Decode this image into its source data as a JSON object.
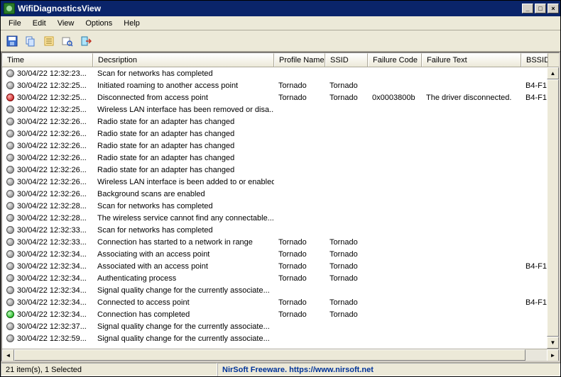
{
  "window": {
    "title": "WifiDiagnosticsView"
  },
  "menu": {
    "file": "File",
    "edit": "Edit",
    "view": "View",
    "options": "Options",
    "help": "Help"
  },
  "columns": {
    "time": "Time",
    "desc": "Decsription",
    "profile": "Profile Name",
    "ssid": "SSID",
    "fcode": "Failure Code",
    "ftext": "Failure Text",
    "bssid": "BSSID"
  },
  "status": {
    "left": "21 item(s), 1 Selected",
    "right": "NirSoft Freeware. https://www.nirsoft.net"
  },
  "rows": [
    {
      "dot": "gray",
      "time": "30/04/22 12:32:23...",
      "desc": "Scan for networks has completed",
      "profile": "",
      "ssid": "",
      "fcode": "",
      "ftext": "",
      "bssid": ""
    },
    {
      "dot": "gray",
      "time": "30/04/22 12:32:25...",
      "desc": "Initiated roaming to another access point",
      "profile": "Tornado",
      "ssid": "Tornado",
      "fcode": "",
      "ftext": "",
      "bssid": "B4-F1"
    },
    {
      "dot": "red",
      "time": "30/04/22 12:32:25...",
      "desc": "Disconnected from access point",
      "profile": "Tornado",
      "ssid": "Tornado",
      "fcode": "0x0003800b",
      "ftext": "The driver disconnected.",
      "bssid": "B4-F1"
    },
    {
      "dot": "gray",
      "time": "30/04/22 12:32:25...",
      "desc": "Wireless LAN interface has been removed or disa...",
      "profile": "",
      "ssid": "",
      "fcode": "",
      "ftext": "",
      "bssid": ""
    },
    {
      "dot": "gray",
      "time": "30/04/22 12:32:26...",
      "desc": "Radio state for an adapter has changed",
      "profile": "",
      "ssid": "",
      "fcode": "",
      "ftext": "",
      "bssid": ""
    },
    {
      "dot": "gray",
      "time": "30/04/22 12:32:26...",
      "desc": "Radio state for an adapter has changed",
      "profile": "",
      "ssid": "",
      "fcode": "",
      "ftext": "",
      "bssid": ""
    },
    {
      "dot": "gray",
      "time": "30/04/22 12:32:26...",
      "desc": "Radio state for an adapter has changed",
      "profile": "",
      "ssid": "",
      "fcode": "",
      "ftext": "",
      "bssid": ""
    },
    {
      "dot": "gray",
      "time": "30/04/22 12:32:26...",
      "desc": "Radio state for an adapter has changed",
      "profile": "",
      "ssid": "",
      "fcode": "",
      "ftext": "",
      "bssid": ""
    },
    {
      "dot": "gray",
      "time": "30/04/22 12:32:26...",
      "desc": "Radio state for an adapter has changed",
      "profile": "",
      "ssid": "",
      "fcode": "",
      "ftext": "",
      "bssid": ""
    },
    {
      "dot": "gray",
      "time": "30/04/22 12:32:26...",
      "desc": "Wireless LAN interface is been added to or enabled",
      "profile": "",
      "ssid": "",
      "fcode": "",
      "ftext": "",
      "bssid": ""
    },
    {
      "dot": "gray",
      "time": "30/04/22 12:32:26...",
      "desc": "Background scans are enabled",
      "profile": "",
      "ssid": "",
      "fcode": "",
      "ftext": "",
      "bssid": ""
    },
    {
      "dot": "gray",
      "time": "30/04/22 12:32:28...",
      "desc": "Scan for networks has completed",
      "profile": "",
      "ssid": "",
      "fcode": "",
      "ftext": "",
      "bssid": ""
    },
    {
      "dot": "gray",
      "time": "30/04/22 12:32:28...",
      "desc": "The wireless service cannot find any connectable...",
      "profile": "",
      "ssid": "",
      "fcode": "",
      "ftext": "",
      "bssid": ""
    },
    {
      "dot": "gray",
      "time": "30/04/22 12:32:33...",
      "desc": "Scan for networks has completed",
      "profile": "",
      "ssid": "",
      "fcode": "",
      "ftext": "",
      "bssid": ""
    },
    {
      "dot": "gray",
      "time": "30/04/22 12:32:33...",
      "desc": "Connection has started to a network in range",
      "profile": "Tornado",
      "ssid": "Tornado",
      "fcode": "",
      "ftext": "",
      "bssid": ""
    },
    {
      "dot": "gray",
      "time": "30/04/22 12:32:34...",
      "desc": "Associating with an access point",
      "profile": "Tornado",
      "ssid": "Tornado",
      "fcode": "",
      "ftext": "",
      "bssid": ""
    },
    {
      "dot": "gray",
      "time": "30/04/22 12:32:34...",
      "desc": "Associated with an access point",
      "profile": "Tornado",
      "ssid": "Tornado",
      "fcode": "",
      "ftext": "",
      "bssid": "B4-F1"
    },
    {
      "dot": "gray",
      "time": "30/04/22 12:32:34...",
      "desc": "Authenticating process",
      "profile": "Tornado",
      "ssid": "Tornado",
      "fcode": "",
      "ftext": "",
      "bssid": ""
    },
    {
      "dot": "gray",
      "time": "30/04/22 12:32:34...",
      "desc": "Signal quality change for the currently associate...",
      "profile": "",
      "ssid": "",
      "fcode": "",
      "ftext": "",
      "bssid": ""
    },
    {
      "dot": "gray",
      "time": "30/04/22 12:32:34...",
      "desc": "Connected to access point",
      "profile": "Tornado",
      "ssid": "Tornado",
      "fcode": "",
      "ftext": "",
      "bssid": "B4-F1"
    },
    {
      "dot": "green",
      "time": "30/04/22 12:32:34...",
      "desc": "Connection has completed",
      "profile": "Tornado",
      "ssid": "Tornado",
      "fcode": "",
      "ftext": "",
      "bssid": ""
    },
    {
      "dot": "gray",
      "time": "30/04/22 12:32:37...",
      "desc": "Signal quality change for the currently associate...",
      "profile": "",
      "ssid": "",
      "fcode": "",
      "ftext": "",
      "bssid": ""
    },
    {
      "dot": "gray",
      "time": "30/04/22 12:32:59...",
      "desc": "Signal quality change for the currently associate...",
      "profile": "",
      "ssid": "",
      "fcode": "",
      "ftext": "",
      "bssid": ""
    }
  ]
}
